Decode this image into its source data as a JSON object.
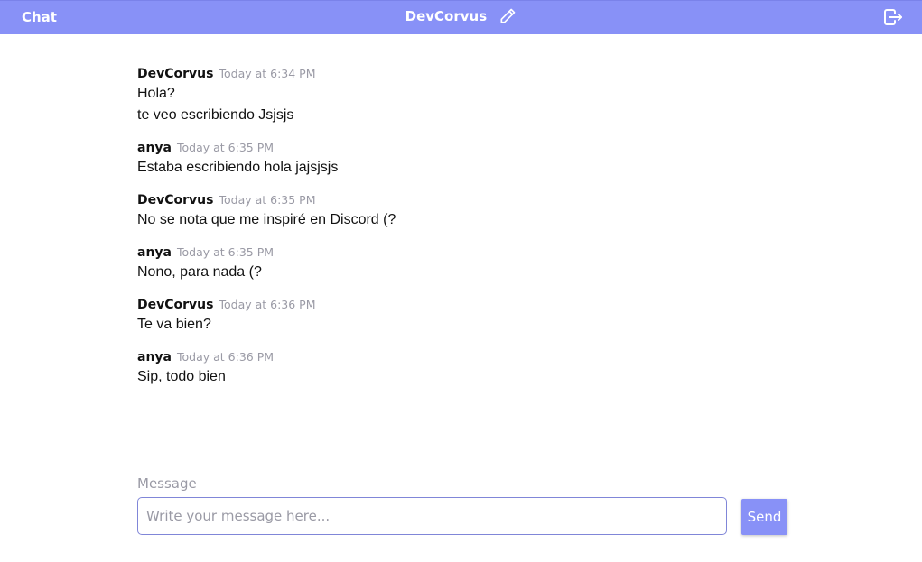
{
  "header": {
    "app_title": "Chat",
    "room_name": "DevCorvus",
    "edit_icon": "pencil-icon",
    "logout_icon": "logout-icon"
  },
  "messages": [
    {
      "author": "DevCorvus",
      "time": "Today at 6:34 PM",
      "lines": [
        "Hola?",
        "te veo escribiendo Jsjsjs"
      ]
    },
    {
      "author": "anya",
      "time": "Today at 6:35 PM",
      "lines": [
        "Estaba escribiendo hola jajsjsjs"
      ]
    },
    {
      "author": "DevCorvus",
      "time": "Today at 6:35 PM",
      "lines": [
        "No se nota que me inspiré en Discord (?"
      ]
    },
    {
      "author": "anya",
      "time": "Today at 6:35 PM",
      "lines": [
        "Nono, para nada (?"
      ]
    },
    {
      "author": "DevCorvus",
      "time": "Today at 6:36 PM",
      "lines": [
        "Te va bien?"
      ]
    },
    {
      "author": "anya",
      "time": "Today at 6:36 PM",
      "lines": [
        "Sip, todo bien"
      ]
    }
  ],
  "composer": {
    "label": "Message",
    "placeholder": "Write your message here...",
    "value": "",
    "send_label": "Send"
  },
  "colors": {
    "accent": "#8891f7",
    "muted_text": "#9a9aa5",
    "input_border": "#8086d8"
  }
}
